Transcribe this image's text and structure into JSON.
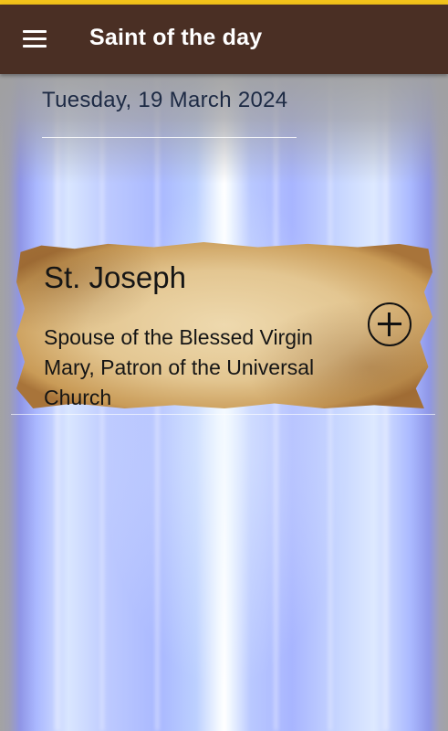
{
  "app_bar": {
    "title": "Saint of the day",
    "menu_icon": "hamburger-menu-icon"
  },
  "date": "Tuesday, 19 March 2024",
  "saint": {
    "name": "St. Joseph",
    "description": "Spouse of the Blessed Virgin Mary, Patron of the Universal Church",
    "add_icon": "circled-plus-icon"
  },
  "colors": {
    "app_bar": "#4a2f24",
    "status_strip": "#f2c21a",
    "date_text": "#1d2a44"
  }
}
